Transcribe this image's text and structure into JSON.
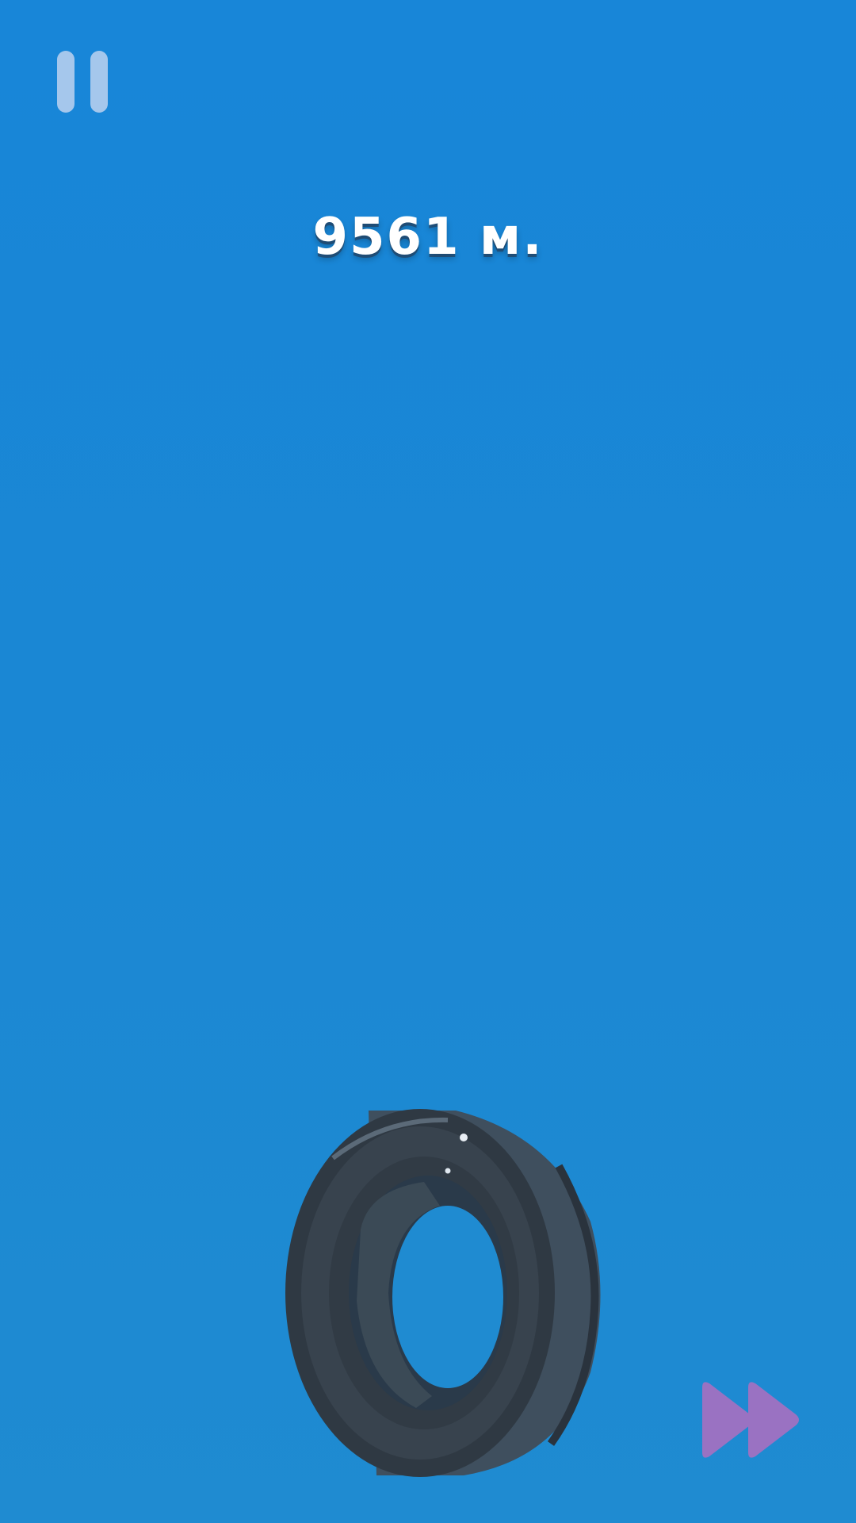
{
  "hud": {
    "distance_text": "9561 м."
  },
  "icons": {
    "pause": "pause-icon",
    "fast_forward": "fast-forward-icon",
    "player": "tire-object"
  },
  "colors": {
    "background": "#1886d8",
    "pause_icon": "#bed2f0",
    "fast_forward_icon": "#9a72c2",
    "distance_text": "#ffffff",
    "tire": "#3a4552"
  }
}
